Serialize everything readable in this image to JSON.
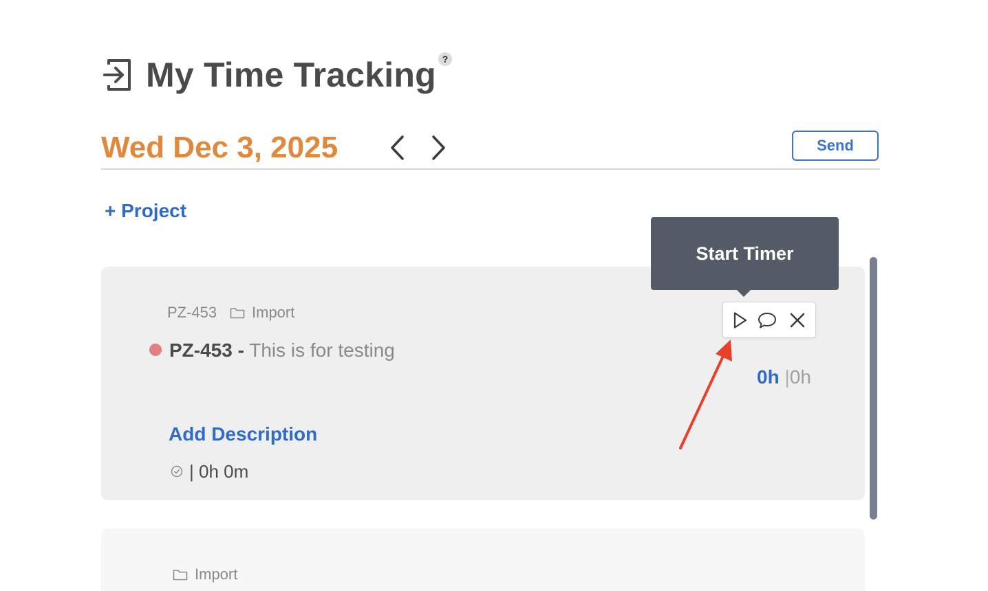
{
  "header": {
    "title": "My Time Tracking",
    "help_label": "?",
    "title_icon": "enter-icon"
  },
  "date_bar": {
    "date": "Wed Dec 3, 2025",
    "send_label": "Send",
    "prev_icon": "chevron-left-icon",
    "next_icon": "chevron-right-icon"
  },
  "add_project_label": "+ Project",
  "tooltip": {
    "text": "Start Timer"
  },
  "task": {
    "meta_id": "PZ-453",
    "meta_project": "Import",
    "status_color": "#e38080",
    "code": "PZ-453 -",
    "title": " This is for testing",
    "add_description_label": "Add Description",
    "duration": "| 0h 0m",
    "time_logged": "0h",
    "time_separator": "|",
    "time_planned": "0h",
    "actions": [
      "play-icon",
      "comment-icon",
      "close-icon"
    ]
  },
  "task2": {
    "meta_project": "Import"
  },
  "colors": {
    "accent_blue": "#2f6bc8",
    "date_orange": "#e0893c",
    "tooltip_bg": "#545a66",
    "annotation_red": "#e8402a"
  }
}
